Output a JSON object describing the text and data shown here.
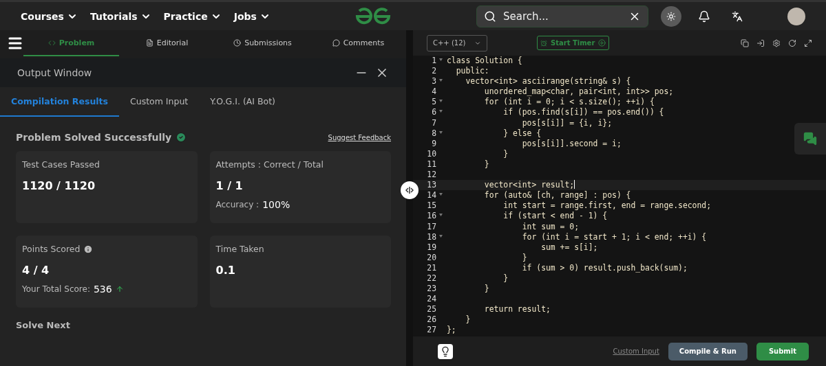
{
  "nav": {
    "menus": [
      "Courses",
      "Tutorials",
      "Practice",
      "Jobs"
    ],
    "search": {
      "placeholder": "Search..."
    }
  },
  "problem_tabs": [
    {
      "label": "Problem",
      "selected": true
    },
    {
      "label": "Editorial",
      "selected": false
    },
    {
      "label": "Submissions",
      "selected": false
    },
    {
      "label": "Comments",
      "selected": false
    }
  ],
  "output_window": {
    "title": "Output Window",
    "tabs": [
      {
        "label": "Compilation Results",
        "selected": true
      },
      {
        "label": "Custom Input",
        "selected": false
      },
      {
        "label": "Y.O.G.I. (AI Bot)",
        "selected": false
      }
    ],
    "status": "Problem Solved Successfully",
    "feedback_link": "Suggest Feedback",
    "cards": [
      {
        "label": "Test Cases Passed",
        "value": "1120 / 1120"
      },
      {
        "label": "Attempts : Correct / Total",
        "value": "1 / 1",
        "sub_label": "Accuracy :",
        "sub_value": "100%"
      },
      {
        "label": "Points Scored",
        "info": true,
        "value": "4 / 4",
        "sub_label": "Your Total Score:",
        "sub_value": "536",
        "trend_up": true
      },
      {
        "label": "Time Taken",
        "value": "0.1"
      }
    ],
    "next_heading": "Solve Next"
  },
  "editor": {
    "language": "C++ (12)",
    "timer_button": "Start Timer",
    "lines": [
      {
        "n": "1",
        "code": "class Solution {",
        "fold": true,
        "current": false
      },
      {
        "n": "2",
        "code": "  public:",
        "fold": false,
        "current": false
      },
      {
        "n": "3",
        "code": "    vector<int> asciirange(string& s) {",
        "fold": true,
        "current": false
      },
      {
        "n": "4",
        "code": "        unordered_map<char, pair<int, int>> pos;",
        "fold": false,
        "current": false
      },
      {
        "n": "5",
        "code": "        for (int i = 0; i < s.size(); ++i) {",
        "fold": true,
        "current": false
      },
      {
        "n": "6",
        "code": "            if (pos.find(s[i]) == pos.end()) {",
        "fold": true,
        "current": false
      },
      {
        "n": "7",
        "code": "                pos[s[i]] = {i, i};",
        "fold": false,
        "current": false
      },
      {
        "n": "8",
        "code": "            } else {",
        "fold": true,
        "current": false
      },
      {
        "n": "9",
        "code": "                pos[s[i]].second = i;",
        "fold": false,
        "current": false
      },
      {
        "n": "10",
        "code": "            }",
        "fold": false,
        "current": false
      },
      {
        "n": "11",
        "code": "        }",
        "fold": false,
        "current": false
      },
      {
        "n": "12",
        "fold": false,
        "current": false
      },
      {
        "n": "13",
        "code": "        vector<int> result;",
        "fold": false,
        "current": true
      },
      {
        "n": "14",
        "code": "        for (auto& [ch, range] : pos) {",
        "fold": true,
        "current": false
      },
      {
        "n": "15",
        "code": "            int start = range.first, end = range.second;",
        "fold": false,
        "current": false
      },
      {
        "n": "16",
        "code": "            if (start < end - 1) {",
        "fold": true,
        "current": false
      },
      {
        "n": "17",
        "code": "                int sum = 0;",
        "fold": false,
        "current": false
      },
      {
        "n": "18",
        "code": "                for (int i = start + 1; i < end; ++i) {",
        "fold": true,
        "current": false
      },
      {
        "n": "19",
        "code": "                    sum += s[i];",
        "fold": false,
        "current": false
      },
      {
        "n": "20",
        "code": "                }",
        "fold": false,
        "current": false
      },
      {
        "n": "21",
        "code": "                if (sum > 0) result.push_back(sum);",
        "fold": false,
        "current": false
      },
      {
        "n": "22",
        "code": "            }",
        "fold": false,
        "current": false
      },
      {
        "n": "23",
        "code": "        }",
        "fold": false,
        "current": false
      },
      {
        "n": "24",
        "fold": false,
        "current": false
      },
      {
        "n": "25",
        "code": "        return result;",
        "fold": false,
        "current": false
      },
      {
        "n": "26",
        "code": "    }",
        "fold": false,
        "current": false
      },
      {
        "n": "27",
        "code": "};",
        "fold": false,
        "current": false
      }
    ],
    "custom_input_link": "Custom Input",
    "compile_button": "Compile & Run",
    "submit_button": "Submit"
  }
}
